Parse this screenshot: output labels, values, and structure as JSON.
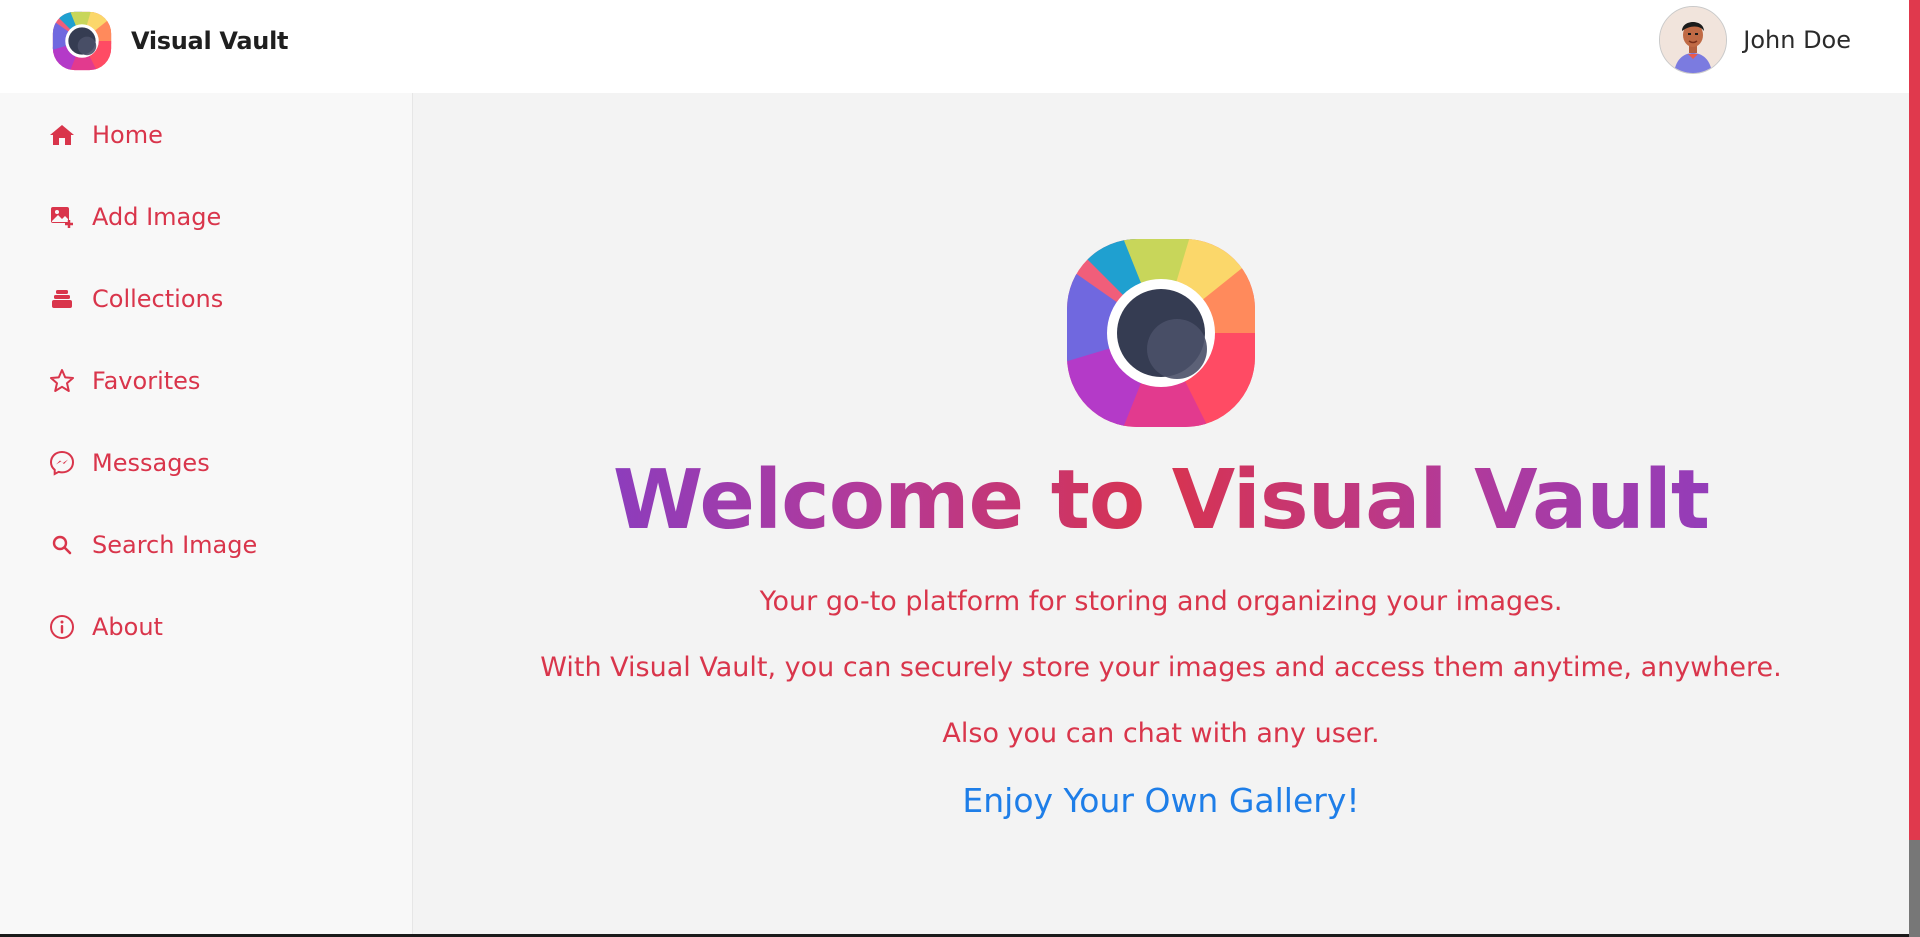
{
  "header": {
    "brand_name": "Visual Vault",
    "user_name": "John Doe"
  },
  "sidebar": {
    "items": [
      {
        "label": "Home",
        "icon": "home-icon"
      },
      {
        "label": "Add Image",
        "icon": "add-image-icon"
      },
      {
        "label": "Collections",
        "icon": "collections-icon"
      },
      {
        "label": "Favorites",
        "icon": "star-icon"
      },
      {
        "label": "Messages",
        "icon": "messenger-icon"
      },
      {
        "label": "Search Image",
        "icon": "search-icon"
      },
      {
        "label": "About",
        "icon": "info-icon"
      }
    ]
  },
  "main": {
    "title": "Welcome to Visual Vault",
    "line1": "Your go-to platform for storing and organizing your images.",
    "line2": "With Visual Vault, you can securely store your images and access them anytime, anywhere.",
    "line3": "Also you can chat with any user.",
    "cta": "Enjoy Your Own Gallery!"
  },
  "colors": {
    "accent": "#d9354b",
    "link": "#1e7ee8",
    "title_gradient_start": "#6f3fd8",
    "title_gradient_mid": "#d8334f"
  }
}
